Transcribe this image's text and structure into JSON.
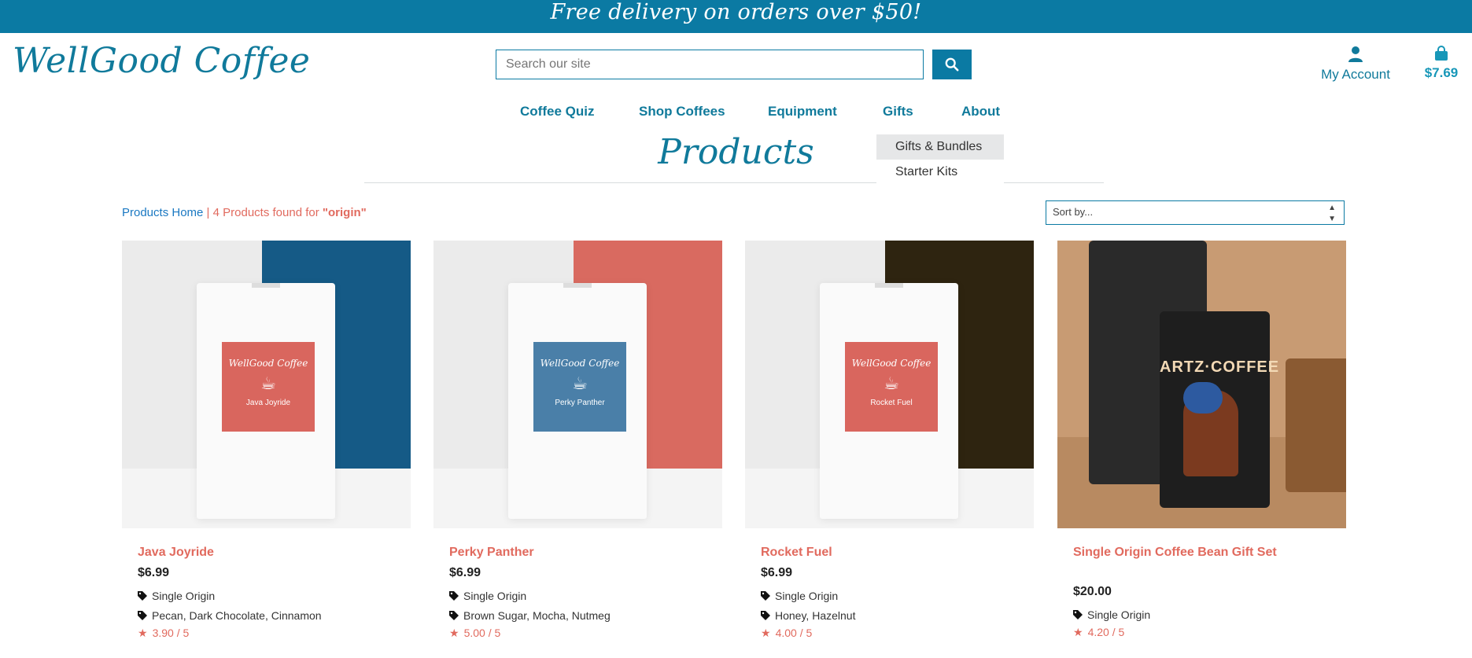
{
  "promo": "Free delivery on orders over $50!",
  "logo": "WellGood Coffee",
  "search": {
    "placeholder": "Search our site"
  },
  "account": {
    "label": "My Account"
  },
  "cart": {
    "total": "$7.69"
  },
  "nav": {
    "items": [
      {
        "label": "Coffee Quiz"
      },
      {
        "label": "Shop Coffees"
      },
      {
        "label": "Equipment"
      },
      {
        "label": "Gifts"
      },
      {
        "label": "About"
      }
    ],
    "dropdown": [
      {
        "label": "Gifts & Bundles"
      },
      {
        "label": "Starter Kits"
      }
    ]
  },
  "page_title": "Products",
  "breadcrumb": {
    "home": "Products Home",
    "separator": "|",
    "result_text": "4 Products found for",
    "query": "\"origin\""
  },
  "sort": {
    "selected": "Sort by..."
  },
  "colors": {
    "brand": "#0b7aa3",
    "accent": "#e16a5e",
    "link": "#1a78c2"
  },
  "products": [
    {
      "name": "Java Joyride",
      "price": "$6.99",
      "tags": [
        "Single Origin",
        "Pecan, Dark Chocolate, Cinnamon"
      ],
      "rating": "3.90 / 5",
      "label_brand": "WellGood Coffee",
      "label_flavor": "Java Joyride",
      "label_color": "#d9665e",
      "panel_color": "#155a86"
    },
    {
      "name": "Perky Panther",
      "price": "$6.99",
      "tags": [
        "Single Origin",
        "Brown Sugar, Mocha, Nutmeg"
      ],
      "rating": "5.00 / 5",
      "label_brand": "WellGood Coffee",
      "label_flavor": "Perky Panther",
      "label_color": "#4a7fa8",
      "panel_color": "#d96a60"
    },
    {
      "name": "Rocket Fuel",
      "price": "$6.99",
      "tags": [
        "Single Origin",
        "Honey, Hazelnut"
      ],
      "rating": "4.00 / 5",
      "label_brand": "WellGood Coffee",
      "label_flavor": "Rocket Fuel",
      "label_color": "#d9665e",
      "panel_color": "#2e2410"
    },
    {
      "name": "Single Origin Coffee Bean Gift Set",
      "price": "$20.00",
      "tags": [
        "Single Origin"
      ],
      "rating": "4.20 / 5",
      "photo_text": "ARTZ·COFFEE"
    }
  ]
}
